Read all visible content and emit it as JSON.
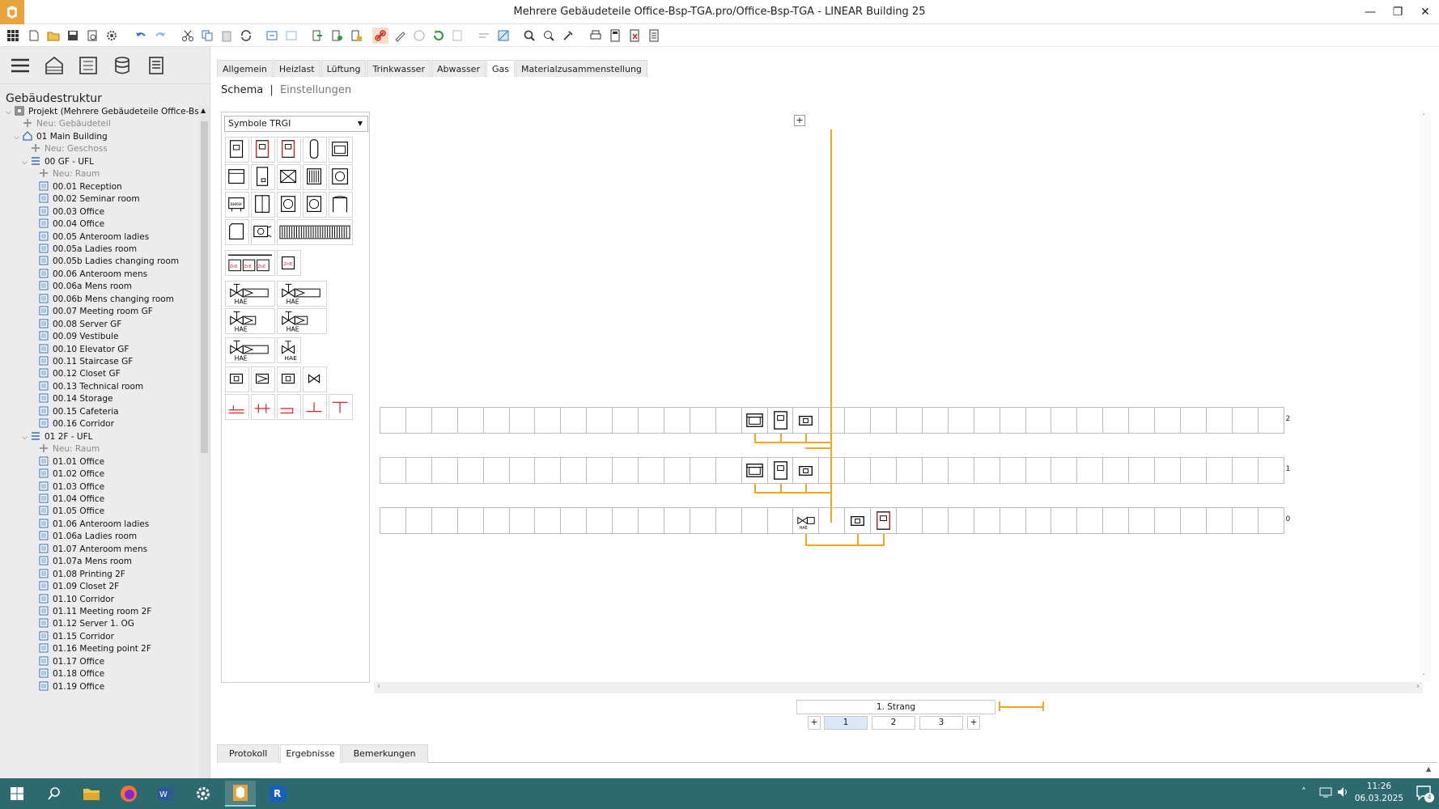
{
  "window": {
    "title": "Mehrere Gebäudeteile Office-Bsp-TGA.pro/Office-Bsp-TGA - LINEAR Building 25"
  },
  "sidebar": {
    "title": "Gebäudestruktur",
    "tree": [
      {
        "label": "Projekt (Mehrere Gebäudeteile Office-Bsp-Tr",
        "level": 0,
        "icon": "project",
        "exp": "v",
        "muted": false
      },
      {
        "label": "Neu: Gebäudeteil",
        "level": 1,
        "icon": "add",
        "exp": "",
        "muted": true
      },
      {
        "label": "01 Main Building",
        "level": 1,
        "icon": "building",
        "exp": "v",
        "muted": false
      },
      {
        "label": "Neu: Geschoss",
        "level": 2,
        "icon": "add",
        "exp": "",
        "muted": true
      },
      {
        "label": "00 GF - UFL",
        "level": 2,
        "icon": "floor",
        "exp": "v",
        "muted": false
      },
      {
        "label": "Neu: Raum",
        "level": 3,
        "icon": "add",
        "exp": "",
        "muted": true
      },
      {
        "label": "00.01 Reception",
        "level": 3,
        "icon": "room",
        "exp": "",
        "muted": false
      },
      {
        "label": "00.02 Seminar room",
        "level": 3,
        "icon": "room",
        "exp": "",
        "muted": false
      },
      {
        "label": "00.03 Office",
        "level": 3,
        "icon": "room",
        "exp": "",
        "muted": false
      },
      {
        "label": "00.04 Office",
        "level": 3,
        "icon": "room",
        "exp": "",
        "muted": false
      },
      {
        "label": "00.05 Anteroom ladies",
        "level": 3,
        "icon": "room",
        "exp": "",
        "muted": false
      },
      {
        "label": "00.05a Ladies room",
        "level": 3,
        "icon": "room",
        "exp": "",
        "muted": false
      },
      {
        "label": "00.05b Ladies changing room",
        "level": 3,
        "icon": "room",
        "exp": "",
        "muted": false
      },
      {
        "label": "00.06 Anteroom mens",
        "level": 3,
        "icon": "room",
        "exp": "",
        "muted": false
      },
      {
        "label": "00.06a Mens room",
        "level": 3,
        "icon": "room",
        "exp": "",
        "muted": false
      },
      {
        "label": "00.06b Mens changing room",
        "level": 3,
        "icon": "room",
        "exp": "",
        "muted": false
      },
      {
        "label": "00.07 Meeting room GF",
        "level": 3,
        "icon": "room",
        "exp": "",
        "muted": false
      },
      {
        "label": "00.08 Server GF",
        "level": 3,
        "icon": "room",
        "exp": "",
        "muted": false
      },
      {
        "label": "00.09 Vestibule",
        "level": 3,
        "icon": "room",
        "exp": "",
        "muted": false
      },
      {
        "label": "00.10 Elevator GF",
        "level": 3,
        "icon": "room",
        "exp": "",
        "muted": false
      },
      {
        "label": "00.11 Staircase GF",
        "level": 3,
        "icon": "room",
        "exp": "",
        "muted": false
      },
      {
        "label": "00.12 Closet GF",
        "level": 3,
        "icon": "room",
        "exp": "",
        "muted": false
      },
      {
        "label": "00.13 Technical room",
        "level": 3,
        "icon": "room",
        "exp": "",
        "muted": false
      },
      {
        "label": "00.14 Storage",
        "level": 3,
        "icon": "room",
        "exp": "",
        "muted": false
      },
      {
        "label": "00.15 Cafeteria",
        "level": 3,
        "icon": "room",
        "exp": "",
        "muted": false
      },
      {
        "label": "00.16 Corridor",
        "level": 3,
        "icon": "room",
        "exp": "",
        "muted": false
      },
      {
        "label": "01 2F - UFL",
        "level": 2,
        "icon": "floor",
        "exp": "v",
        "muted": false
      },
      {
        "label": "Neu: Raum",
        "level": 3,
        "icon": "add",
        "exp": "",
        "muted": true
      },
      {
        "label": "01.01 Office",
        "level": 3,
        "icon": "room",
        "exp": "",
        "muted": false
      },
      {
        "label": "01.02 Office",
        "level": 3,
        "icon": "room",
        "exp": "",
        "muted": false
      },
      {
        "label": "01.03 Office",
        "level": 3,
        "icon": "room",
        "exp": "",
        "muted": false
      },
      {
        "label": "01.04 Office",
        "level": 3,
        "icon": "room",
        "exp": "",
        "muted": false
      },
      {
        "label": "01.05 Office",
        "level": 3,
        "icon": "room",
        "exp": "",
        "muted": false
      },
      {
        "label": "01.06 Anteroom ladies",
        "level": 3,
        "icon": "room",
        "exp": "",
        "muted": false
      },
      {
        "label": "01.06a Ladies room",
        "level": 3,
        "icon": "room",
        "exp": "",
        "muted": false
      },
      {
        "label": "01.07 Anteroom mens",
        "level": 3,
        "icon": "room",
        "exp": "",
        "muted": false
      },
      {
        "label": "01.07a Mens room",
        "level": 3,
        "icon": "room",
        "exp": "",
        "muted": false
      },
      {
        "label": "01.08 Printing 2F",
        "level": 3,
        "icon": "room",
        "exp": "",
        "muted": false
      },
      {
        "label": "01.09 Closet 2F",
        "level": 3,
        "icon": "room",
        "exp": "",
        "muted": false
      },
      {
        "label": "01.10 Corridor",
        "level": 3,
        "icon": "room",
        "exp": "",
        "muted": false
      },
      {
        "label": "01.11 Meeting room 2F",
        "level": 3,
        "icon": "room",
        "exp": "",
        "muted": false
      },
      {
        "label": "01.12 Server 1. OG",
        "level": 3,
        "icon": "room",
        "exp": "",
        "muted": false
      },
      {
        "label": "01.15 Corridor",
        "level": 3,
        "icon": "room",
        "exp": "",
        "muted": false
      },
      {
        "label": "01.16 Meeting point 2F",
        "level": 3,
        "icon": "room",
        "exp": "",
        "muted": false
      },
      {
        "label": "01.17 Office",
        "level": 3,
        "icon": "room",
        "exp": "",
        "muted": false
      },
      {
        "label": "01.18 Office",
        "level": 3,
        "icon": "room",
        "exp": "",
        "muted": false
      },
      {
        "label": "01.19 Office",
        "level": 3,
        "icon": "room",
        "exp": "",
        "muted": false
      }
    ]
  },
  "tabs": [
    "Allgemein",
    "Heizlast",
    "Lüftung",
    "Trinkwasser",
    "Abwasser",
    "Gas",
    "Materialzusammenstellung"
  ],
  "active_tab": "Gas",
  "subtabs": {
    "schema": "Schema",
    "sep": "|",
    "settings": "Einstellungen"
  },
  "palette": {
    "select_value": "Symbole TRGI",
    "hae_label": "HAE"
  },
  "schema": {
    "floors": [
      "2",
      "1",
      "0"
    ],
    "strang_label": "1. Strang",
    "pages": [
      "1",
      "2",
      "3"
    ],
    "plus": "+",
    "pipe_color": "#f4a620"
  },
  "bottom_tabs": [
    "Protokoll",
    "Ergebnisse",
    "Bemerkungen"
  ],
  "active_bottom_tab": "Ergebnisse",
  "taskbar": {
    "time": "11:26",
    "date": "06.03.2025",
    "notif_count": "4"
  },
  "colors": {
    "accent": "#e8a33c",
    "taskbar": "#2c6a70",
    "symbol_red": "#e02020"
  }
}
